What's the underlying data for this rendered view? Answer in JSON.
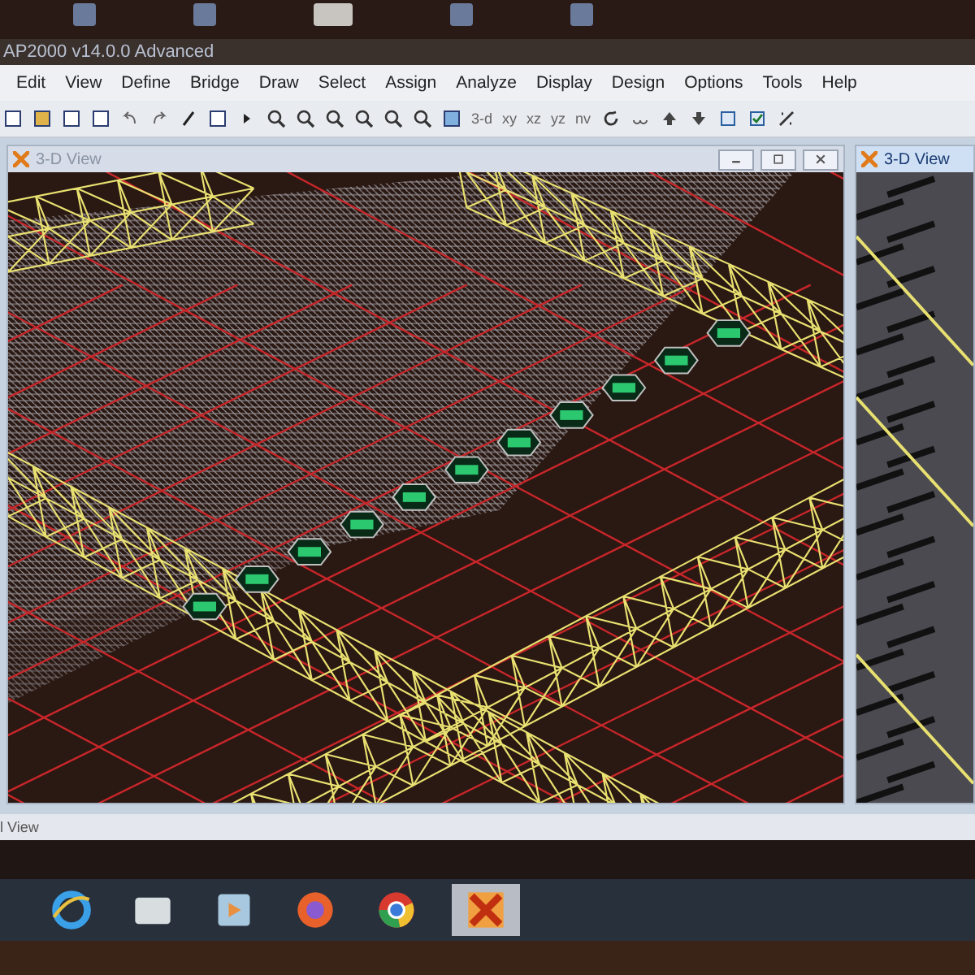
{
  "app_title": "AP2000 v14.0.0 Advanced",
  "menu": [
    "Edit",
    "View",
    "Define",
    "Bridge",
    "Draw",
    "Select",
    "Assign",
    "Analyze",
    "Display",
    "Design",
    "Options",
    "Tools",
    "Help"
  ],
  "toolbar_views": [
    "3-d",
    "xy",
    "xz",
    "yz",
    "nv"
  ],
  "windows": [
    {
      "title": "3-D View",
      "selected": false
    },
    {
      "title": "3-D View",
      "selected": true
    }
  ],
  "status_bar": "l View",
  "taskbar": [
    {
      "kind": "browser-e",
      "selected": false
    },
    {
      "kind": "folder",
      "selected": false
    },
    {
      "kind": "media",
      "selected": false
    },
    {
      "kind": "fox",
      "selected": false
    },
    {
      "kind": "chrome",
      "selected": false
    },
    {
      "kind": "sap",
      "selected": true
    }
  ]
}
